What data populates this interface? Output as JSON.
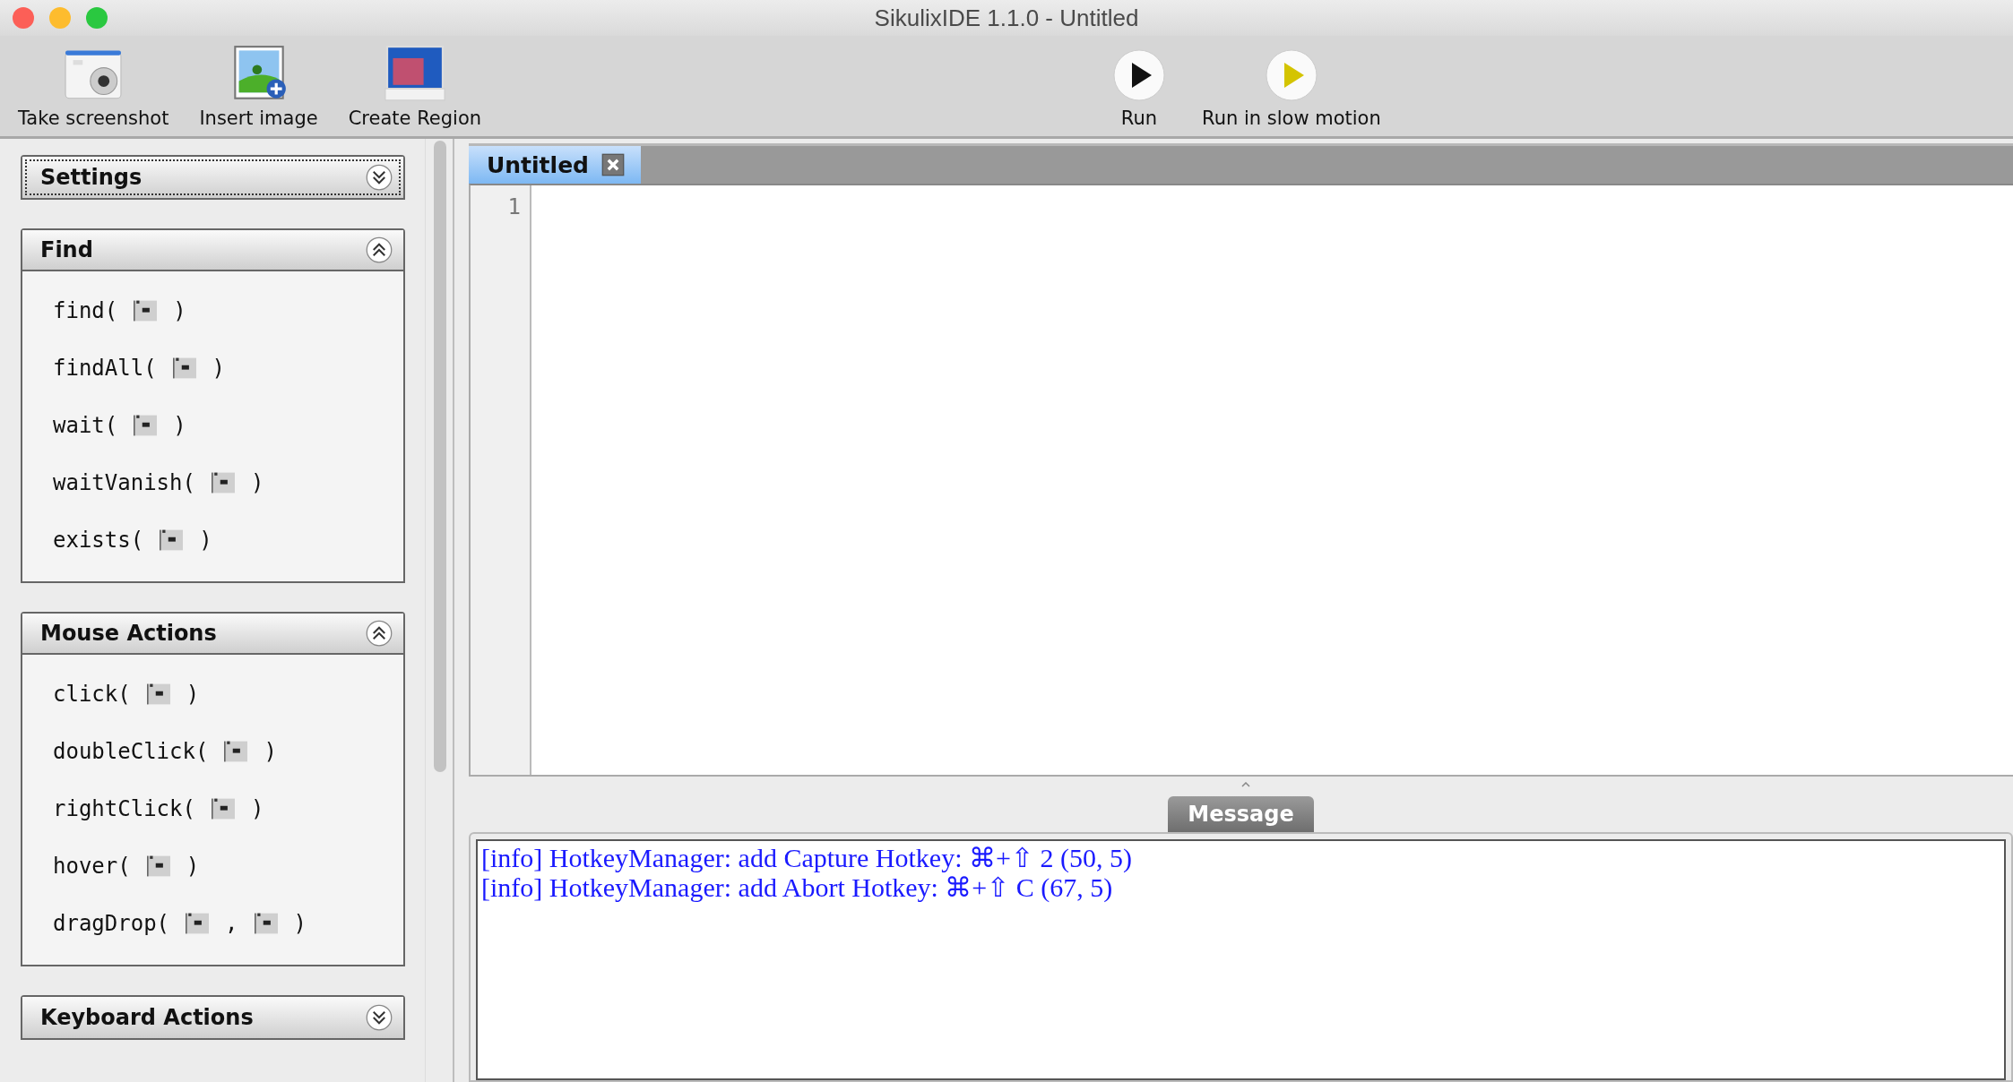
{
  "window": {
    "title": "SikulixIDE 1.1.0 - Untitled"
  },
  "toolbar": {
    "left": [
      {
        "kind": "camera",
        "label": "Take screenshot"
      },
      {
        "kind": "picture",
        "label": "Insert image"
      },
      {
        "kind": "monitor",
        "label": "Create Region"
      }
    ],
    "right": [
      {
        "kind": "run",
        "label": "Run"
      },
      {
        "kind": "slow",
        "label": "Run in slow motion"
      }
    ]
  },
  "sidebar": {
    "sections": [
      {
        "title": "Settings",
        "expanded": false,
        "focused": true
      },
      {
        "title": "Find",
        "expanded": true,
        "focused": false,
        "items": [
          {
            "parts": [
              {
                "kind": "text",
                "text": "find("
              },
              {
                "kind": "image"
              },
              {
                "kind": "text",
                "text": ")"
              }
            ]
          },
          {
            "parts": [
              {
                "kind": "text",
                "text": "findAll("
              },
              {
                "kind": "image"
              },
              {
                "kind": "text",
                "text": ")"
              }
            ]
          },
          {
            "parts": [
              {
                "kind": "text",
                "text": "wait("
              },
              {
                "kind": "image"
              },
              {
                "kind": "text",
                "text": ")"
              }
            ]
          },
          {
            "parts": [
              {
                "kind": "text",
                "text": "waitVanish("
              },
              {
                "kind": "image"
              },
              {
                "kind": "text",
                "text": ")"
              }
            ]
          },
          {
            "parts": [
              {
                "kind": "text",
                "text": "exists("
              },
              {
                "kind": "image"
              },
              {
                "kind": "text",
                "text": ")"
              }
            ]
          }
        ]
      },
      {
        "title": "Mouse Actions",
        "expanded": true,
        "focused": false,
        "items": [
          {
            "parts": [
              {
                "kind": "text",
                "text": "click("
              },
              {
                "kind": "image"
              },
              {
                "kind": "text",
                "text": ")"
              }
            ]
          },
          {
            "parts": [
              {
                "kind": "text",
                "text": "doubleClick("
              },
              {
                "kind": "image"
              },
              {
                "kind": "text",
                "text": ")"
              }
            ]
          },
          {
            "parts": [
              {
                "kind": "text",
                "text": "rightClick("
              },
              {
                "kind": "image"
              },
              {
                "kind": "text",
                "text": ")"
              }
            ]
          },
          {
            "parts": [
              {
                "kind": "text",
                "text": "hover("
              },
              {
                "kind": "image"
              },
              {
                "kind": "text",
                "text": ")"
              }
            ]
          },
          {
            "parts": [
              {
                "kind": "text",
                "text": "dragDrop("
              },
              {
                "kind": "image"
              },
              {
                "kind": "text",
                "text": ","
              },
              {
                "kind": "image"
              },
              {
                "kind": "text",
                "text": ")"
              }
            ]
          }
        ]
      },
      {
        "title": "Keyboard Actions",
        "expanded": false,
        "focused": false
      }
    ]
  },
  "editor": {
    "tabs": [
      {
        "label": "Untitled",
        "selected": true
      }
    ],
    "line_numbers": [
      "1"
    ]
  },
  "message": {
    "tab": "Message",
    "lines": [
      "[info] HotkeyManager: add Capture Hotkey: ⌘+⇧ 2 (50, 5)",
      "[info] HotkeyManager: add Abort Hotkey: ⌘+⇧ C (67, 5)"
    ]
  }
}
